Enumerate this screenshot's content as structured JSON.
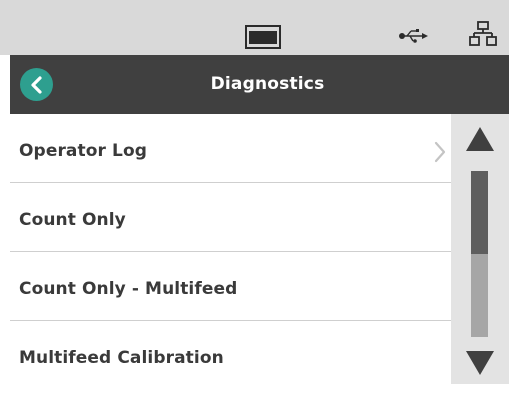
{
  "status_bar": {
    "icons": [
      "display-icon",
      "usb-icon",
      "network-icon"
    ]
  },
  "header": {
    "title": "Diagnostics",
    "back_icon": "chevron-left-icon",
    "accent_color": "#2e9f8f"
  },
  "list": {
    "items": [
      {
        "label": "Operator Log",
        "has_chevron": true
      },
      {
        "label": "Count Only",
        "has_chevron": false
      },
      {
        "label": "Count Only - Multifeed",
        "has_chevron": false
      },
      {
        "label": "Multifeed Calibration",
        "has_chevron": false
      }
    ]
  },
  "scrollbar": {
    "up_icon": "triangle-up-icon",
    "down_icon": "triangle-down-icon",
    "position_fraction": 0.5
  }
}
